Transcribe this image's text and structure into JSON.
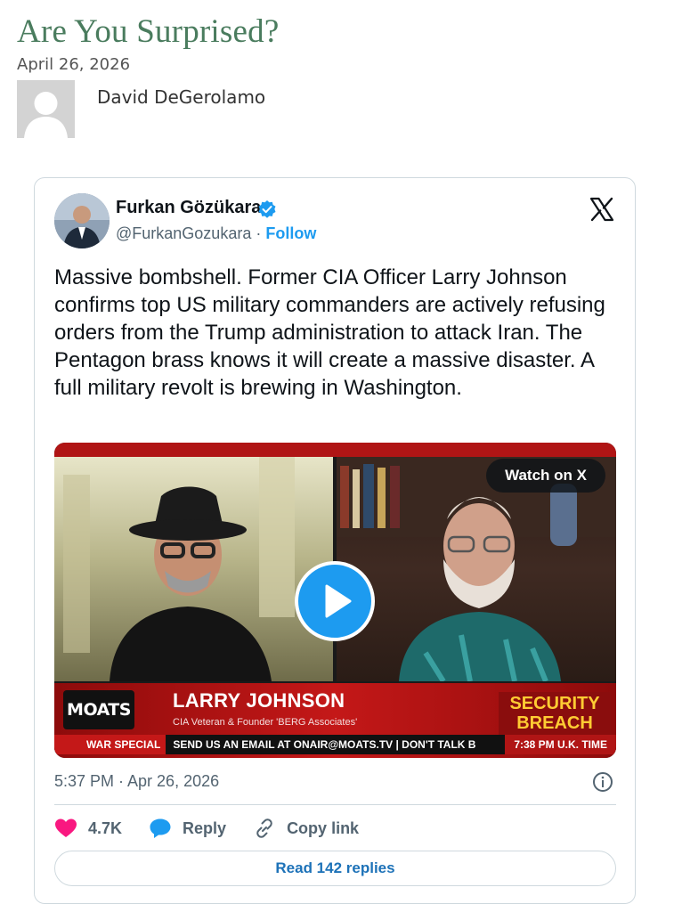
{
  "post": {
    "title": "Are You Surprised?",
    "date": "April 26, 2026",
    "author": "David DeGerolamo"
  },
  "tweet": {
    "name": "Furkan Gözükara",
    "handle": "@FurkanGozukara",
    "separator": " · ",
    "follow": "Follow",
    "text": "Massive bombshell. Former CIA Officer Larry Johnson confirms top US military commanders are actively refusing orders from the Trump administration to attack Iran. The Pentagon brass knows it will create a massive disaster. A full military revolt is brewing in Washington.",
    "timestamp": "5:37 PM · Apr 26, 2026",
    "likes": "4.7K",
    "reply_label": "Reply",
    "copy_link_label": "Copy link",
    "read_replies": "Read 142 replies",
    "colors": {
      "like": "#f91880",
      "accent": "#1d9bf0",
      "verified": "#1d9bf0"
    }
  },
  "video": {
    "watch_label": "Watch on X",
    "logo": "MOATS",
    "lower_third_name": "LARRY JOHNSON",
    "lower_third_sub": "CIA Veteran & Founder 'BERG Associates'",
    "breach_line1": "SECURITY",
    "breach_line2": "BREACH",
    "ticker_tag": "WAR SPECIAL",
    "ticker_text": "SEND US AN EMAIL AT ONAIR@MOATS.TV   |   DON'T TALK B",
    "ticker_time": "7:38 PM U.K. TIME"
  }
}
